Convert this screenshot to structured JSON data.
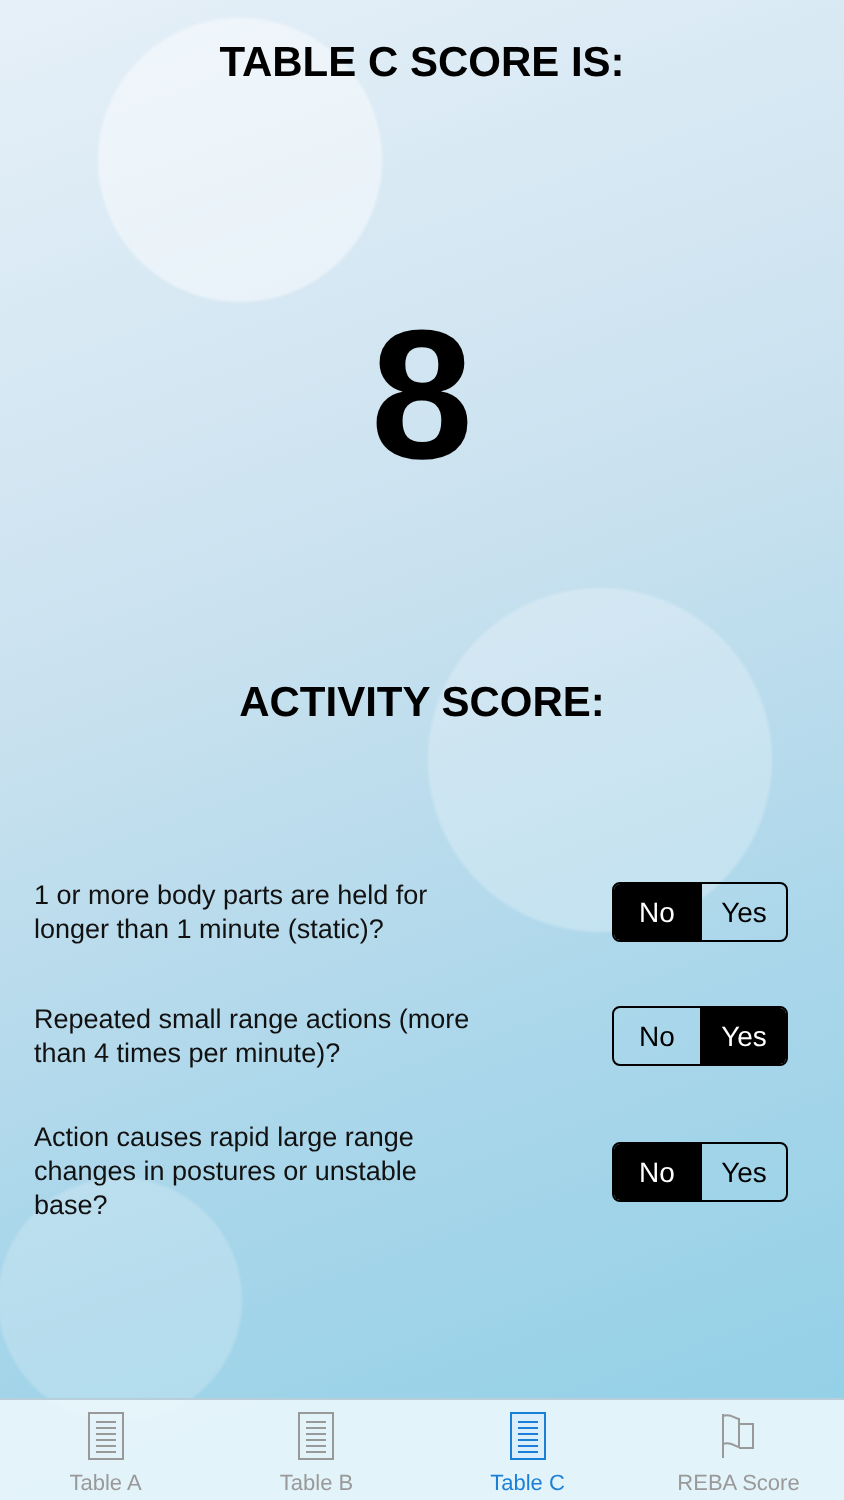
{
  "table_c": {
    "heading": "TABLE C SCORE IS:",
    "score": "8"
  },
  "activity": {
    "heading": "ACTIVITY SCORE:",
    "questions": [
      {
        "text": "1 or more body parts are held for longer than 1 minute (static)?",
        "options": [
          {
            "label": "No",
            "selected": true
          },
          {
            "label": "Yes",
            "selected": false
          }
        ]
      },
      {
        "text": "Repeated small range actions (more than 4 times per minute)?",
        "options": [
          {
            "label": "No",
            "selected": false
          },
          {
            "label": "Yes",
            "selected": true
          }
        ]
      },
      {
        "text": "Action causes rapid large range changes in postures or unstable base?",
        "options": [
          {
            "label": "No",
            "selected": true
          },
          {
            "label": "Yes",
            "selected": false
          }
        ]
      }
    ]
  },
  "tabs": [
    {
      "label": "Table A",
      "kind": "document",
      "selected": false
    },
    {
      "label": "Table B",
      "kind": "document",
      "selected": false
    },
    {
      "label": "Table C",
      "kind": "document",
      "selected": true
    },
    {
      "label": "REBA Score",
      "kind": "flag",
      "selected": false
    }
  ]
}
